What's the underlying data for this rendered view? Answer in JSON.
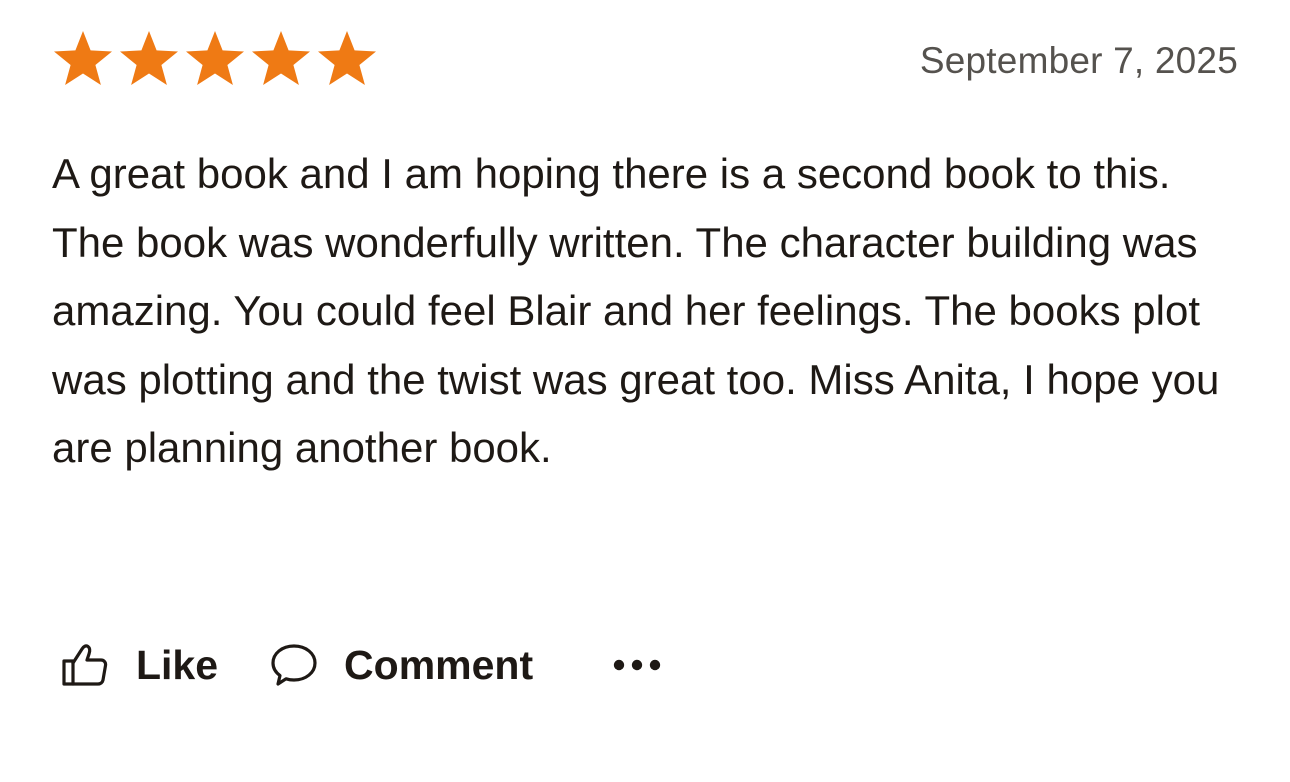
{
  "review": {
    "rating": 5,
    "rating_max": 5,
    "star_color": "#ef7a14",
    "date": "September 7, 2025",
    "text": "A great book and I am hoping there is a second book to this. The book was wonderfully written. The character building was amazing. You could feel Blair and her feelings. The books plot was plotting and the twist was great too. Miss Anita, I hope you are planning another book."
  },
  "actions": {
    "like_label": "Like",
    "like_icon": "thumbs-up-icon",
    "comment_label": "Comment",
    "comment_icon": "speech-bubble-icon",
    "more_icon": "more-options-icon"
  }
}
